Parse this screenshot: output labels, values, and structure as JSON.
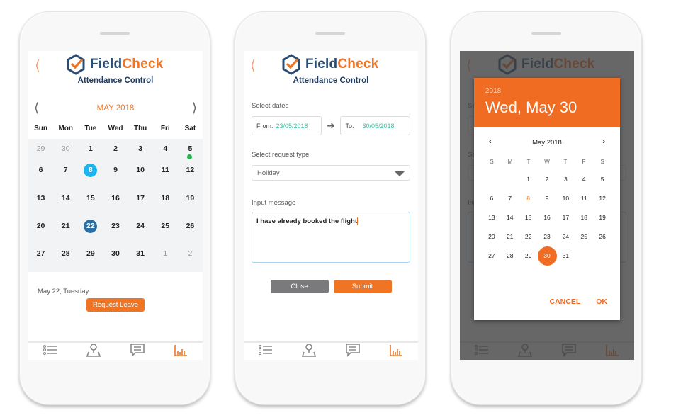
{
  "brand": {
    "part1": "Field",
    "part2": "Check",
    "subtitle": "Attendance Control"
  },
  "colors": {
    "accent": "#ef7424",
    "navy": "#2b4d73",
    "green": "#3cbf9d",
    "today_blue": "#1ab4ef",
    "selected_blue": "#2b6ea3"
  },
  "phone1": {
    "month_label": "MAY 2018",
    "weekdays": [
      "Sun",
      "Mon",
      "Tue",
      "Wed",
      "Thu",
      "Fri",
      "Sat"
    ],
    "weeks": [
      [
        "29",
        "30",
        "1",
        "2",
        "3",
        "4",
        "5"
      ],
      [
        "6",
        "7",
        "8",
        "9",
        "10",
        "11",
        "12"
      ],
      [
        "13",
        "14",
        "15",
        "16",
        "17",
        "18",
        "19"
      ],
      [
        "20",
        "21",
        "22",
        "23",
        "24",
        "25",
        "26"
      ],
      [
        "27",
        "28",
        "29",
        "30",
        "31",
        "1",
        "2"
      ]
    ],
    "today": "8",
    "selected": "22",
    "event_dot_day": "5",
    "selected_date_text": "May 22, Tuesday",
    "request_button": "Request Leave"
  },
  "phone2": {
    "select_dates_label": "Select dates",
    "from_label": "From:",
    "from_value": "23/05/2018",
    "to_label": "To:",
    "to_value": "30/05/2018",
    "request_type_label": "Select request type",
    "request_type_value": "Holiday",
    "message_label": "Input message",
    "message_value": "I have already booked the flight",
    "close_button": "Close",
    "submit_button": "Submit"
  },
  "phone3": {
    "year": "2018",
    "selected_date": "Wed, May 30",
    "month_label": "May 2018",
    "weekdays": [
      "S",
      "M",
      "T",
      "W",
      "T",
      "F",
      "S"
    ],
    "weeks": [
      [
        "",
        "",
        "1",
        "2",
        "3",
        "4",
        "5"
      ],
      [
        "6",
        "7",
        "8",
        "9",
        "10",
        "11",
        "12"
      ],
      [
        "13",
        "14",
        "15",
        "16",
        "17",
        "18",
        "19"
      ],
      [
        "20",
        "21",
        "22",
        "23",
        "24",
        "25",
        "26"
      ],
      [
        "27",
        "28",
        "29",
        "30",
        "31",
        "",
        ""
      ]
    ],
    "today": "8",
    "selected": "30",
    "cancel_button": "CANCEL",
    "ok_button": "OK"
  },
  "tabbar": {
    "items": [
      "list-icon",
      "map-pin-icon",
      "chat-icon",
      "bar-chart-icon"
    ],
    "active": 3
  }
}
